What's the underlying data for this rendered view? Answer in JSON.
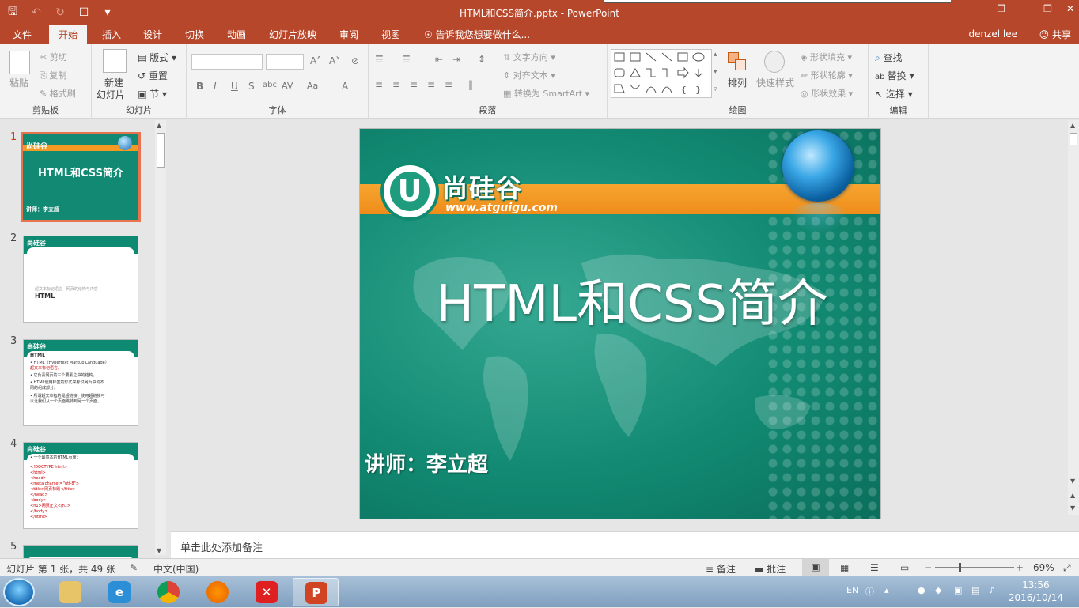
{
  "window": {
    "title": "HTML和CSS简介.pptx - PowerPoint",
    "qat": {
      "save_icon": "save-icon",
      "undo_icon": "undo-icon",
      "redo_icon": "redo-icon",
      "present_icon": "present-icon",
      "more_icon": "customize-icon"
    }
  },
  "tabs": [
    {
      "label": "文件"
    },
    {
      "label": "开始"
    },
    {
      "label": "插入"
    },
    {
      "label": "设计"
    },
    {
      "label": "切换"
    },
    {
      "label": "动画"
    },
    {
      "label": "幻灯片放映"
    },
    {
      "label": "审阅"
    },
    {
      "label": "视图"
    },
    {
      "label": "告诉我您想要做什么..."
    }
  ],
  "user": {
    "name": "denzel lee",
    "share": "共享"
  },
  "ribbon": {
    "clipboard": {
      "label": "剪贴板",
      "paste": "粘贴",
      "cut": "剪切",
      "copy": "复制",
      "format_painter": "格式刷"
    },
    "slides": {
      "label": "幻灯片",
      "new_slide_line1": "新建",
      "new_slide_line2": "幻灯片",
      "layout": "版式",
      "reset": "重置",
      "section": "节"
    },
    "font": {
      "label": "字体",
      "bold": "B",
      "italic": "I",
      "underline": "U",
      "shadow": "S",
      "strike": "abc",
      "spacing": "AV",
      "case": "Aa",
      "color": "A"
    },
    "paragraph": {
      "label": "段落",
      "text_direction": "文字方向",
      "align_text": "对齐文本",
      "smartart": "转换为 SmartArt"
    },
    "drawing": {
      "label": "绘图",
      "arrange": "排列",
      "quick_styles": "快速样式",
      "shape_fill": "形状填充",
      "shape_outline": "形状轮廓",
      "shape_effects": "形状效果"
    },
    "editing": {
      "label": "编辑",
      "find": "查找",
      "replace": "替换",
      "select": "选择"
    }
  },
  "thumbnails": [
    {
      "num": "1",
      "title": "HTML和CSS简介",
      "sub": "讲师：李立超"
    },
    {
      "num": "2",
      "line1": "HTML",
      "small": "超文本标记语言 · 网页的结构与内容"
    },
    {
      "num": "3",
      "head": "HTML",
      "lines": [
        "• HTML（Hypertext Markup Language）",
        "  超文本标记语言。",
        "• 它负责网页的三个要素之中的结构。",
        "• HTML使用标签的形式来标识网页中的不",
        "  同的组成部分。",
        "• 所谓超文本指的是超链接，使用超链接可",
        "  以让我们从一个页面跳转到另一个页面。"
      ]
    },
    {
      "num": "4",
      "head": "• 一个最基本的HTML页面：",
      "lines": [
        "<!DOCTYPE html>",
        "<html>",
        "<head>",
        "    <meta charset=\"utf-8\">",
        "    <title>网页标题</title>",
        "</head>",
        "<body>",
        "    <h1>网页正文</h1>",
        "</body>",
        "</html>"
      ]
    },
    {
      "num": "5"
    }
  ],
  "slide": {
    "brand": "尚硅谷",
    "url": "www.atguigu.com",
    "logo_letter": "U",
    "title": "HTML和CSS简介",
    "lecturer": "讲师：李立超"
  },
  "notes_placeholder": "单击此处添加备注",
  "status": {
    "slide_info": "幻灯片 第 1 张，共 49 张",
    "language": "中文(中国)",
    "notes": "备注",
    "comments": "批注",
    "zoom": "69%"
  },
  "taskbar": {
    "time": "13:56",
    "date": "2016/10/14",
    "lang": "EN"
  },
  "colors": {
    "accent": "#b7472a",
    "slide_bg": "#0f8770",
    "stripe": "#f29a22"
  }
}
